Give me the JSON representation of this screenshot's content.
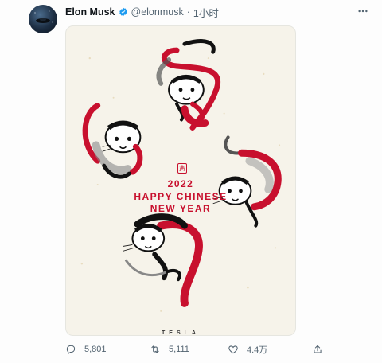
{
  "tweet": {
    "author": {
      "display_name": "Elon Musk",
      "handle": "@elonmusk",
      "separator": "·",
      "time": "1小时",
      "verified_icon": "verified-badge-icon"
    },
    "media": {
      "year": "2022",
      "greeting_line1": "HAPPY CHINESE",
      "greeting_line2": "NEW YEAR",
      "seal_char": "寅",
      "brand": "TESLA",
      "colors": {
        "red": "#c8102e",
        "ink": "#111111",
        "paper": "#f6f3ea"
      }
    },
    "actions": {
      "reply_count": "5,801",
      "retweet_count": "5,111",
      "like_count": "4.4万"
    },
    "colors": {
      "verified": "#1d9bf0",
      "muted": "#536471"
    }
  }
}
